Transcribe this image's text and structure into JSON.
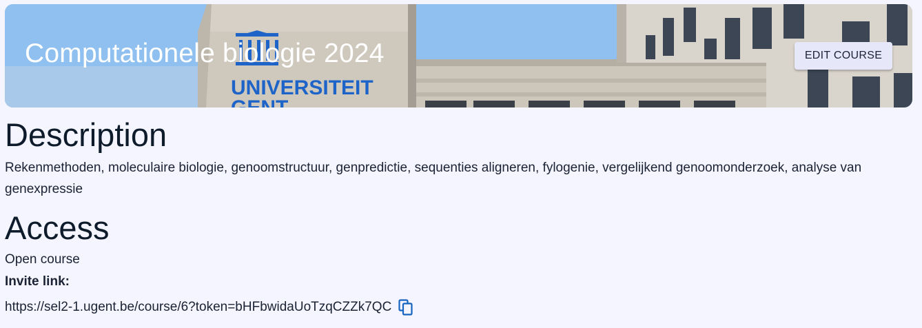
{
  "course": {
    "title": "Computationele biologie 2024",
    "banner_image": "Universiteit Gent building",
    "banner_logo_text": [
      "UNIVERSITEIT",
      "GENT"
    ]
  },
  "toolbar": {
    "edit_label": "EDIT COURSE"
  },
  "description": {
    "heading": "Description",
    "text": "Rekenmethoden, moleculaire biologie, genoomstructuur, genpredictie, sequenties aligneren, fylogenie, vergelijkend genoomonderzoek, analyse van genexpressie"
  },
  "access": {
    "heading": "Access",
    "type": "Open course",
    "invite_label": "Invite link:",
    "invite_url": "https://sel2-1.ugent.be/course/6?token=bHFbwidaUoTzqCZZk7QC",
    "copy_icon": "copy-icon"
  },
  "colors": {
    "background": "#f5f5ff",
    "text": "#0d1b2a",
    "button_bg": "#e6e8fa",
    "icon_blue": "#1565c0",
    "logo_blue": "#1e64c8"
  }
}
